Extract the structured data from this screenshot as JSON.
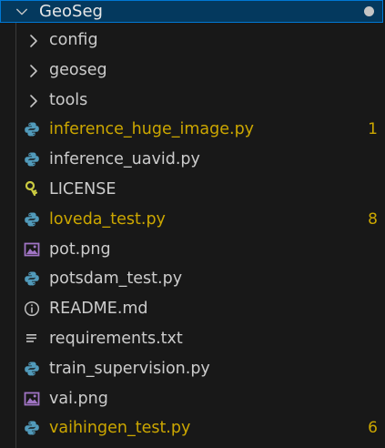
{
  "explorer": {
    "root_label": "GeoSeg",
    "items": [
      {
        "label": "config",
        "type": "folder",
        "icon": "chevron-right-icon"
      },
      {
        "label": "geoseg",
        "type": "folder",
        "icon": "chevron-right-icon"
      },
      {
        "label": "tools",
        "type": "folder",
        "icon": "chevron-right-icon"
      },
      {
        "label": "inference_huge_image.py",
        "type": "python",
        "icon": "python-icon",
        "badge": "1",
        "warning": true
      },
      {
        "label": "inference_uavid.py",
        "type": "python",
        "icon": "python-icon"
      },
      {
        "label": "LICENSE",
        "type": "license",
        "icon": "key-icon"
      },
      {
        "label": "loveda_test.py",
        "type": "python",
        "icon": "python-icon",
        "badge": "8",
        "warning": true
      },
      {
        "label": "pot.png",
        "type": "image",
        "icon": "image-icon"
      },
      {
        "label": "potsdam_test.py",
        "type": "python",
        "icon": "python-icon"
      },
      {
        "label": "README.md",
        "type": "markdown",
        "icon": "info-icon"
      },
      {
        "label": "requirements.txt",
        "type": "text",
        "icon": "lines-icon"
      },
      {
        "label": "train_supervision.py",
        "type": "python",
        "icon": "python-icon"
      },
      {
        "label": "vai.png",
        "type": "image",
        "icon": "image-icon"
      },
      {
        "label": "vaihingen_test.py",
        "type": "python",
        "icon": "python-icon",
        "badge": "6",
        "warning": true
      }
    ]
  },
  "colors": {
    "background": "#181818",
    "header_background": "#04395e",
    "focus_border": "#0078d4",
    "text": "#cccccc",
    "warning_text": "#cca700",
    "python_icon": "#519aba",
    "image_icon": "#a074c4",
    "license_icon": "#cbcb41"
  }
}
